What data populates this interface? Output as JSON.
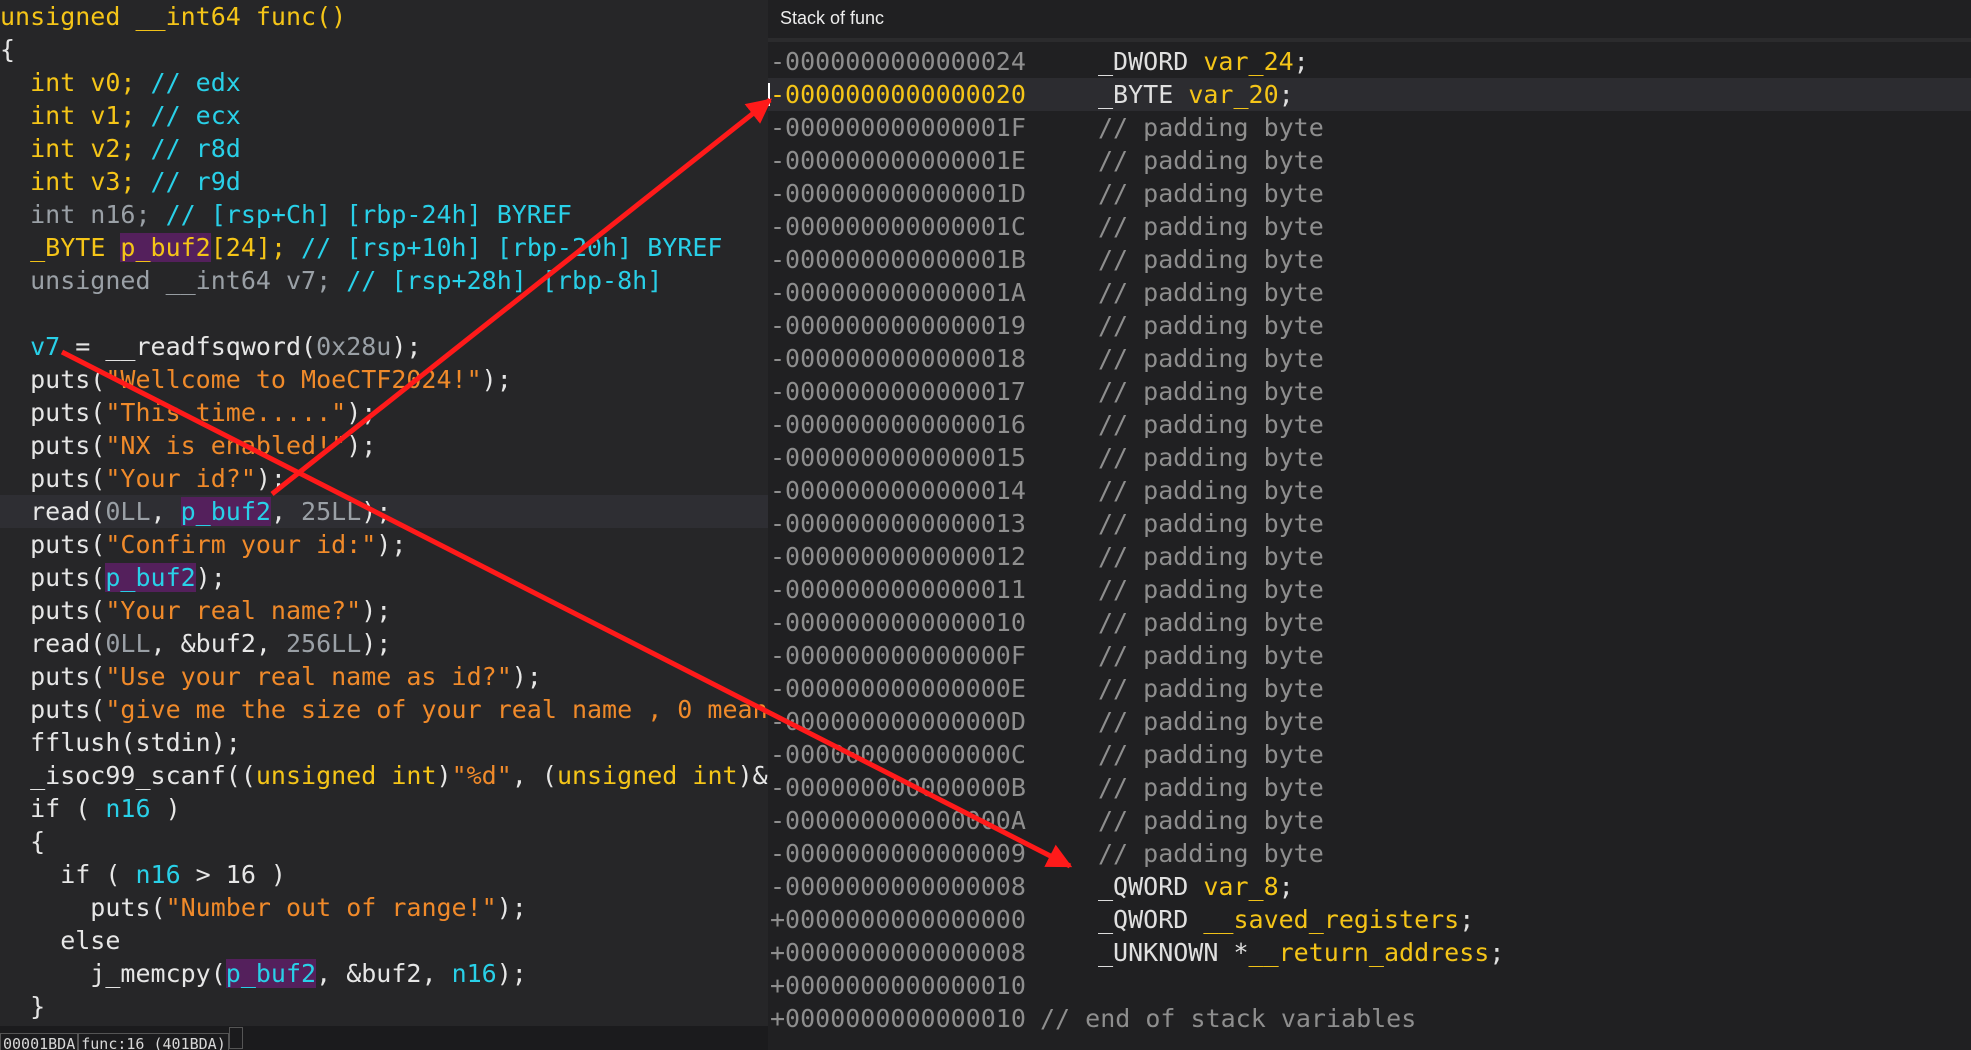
{
  "left_pane": {
    "lines": [
      {
        "segs": [
          {
            "t": "unsigned __int64 func()",
            "c": "kw"
          }
        ]
      },
      {
        "segs": [
          {
            "t": "{",
            "c": ""
          }
        ]
      },
      {
        "segs": [
          {
            "t": "  ",
            "c": ""
          },
          {
            "t": "int",
            "c": "ty"
          },
          {
            "t": " v0; ",
            "c": "kw"
          },
          {
            "t": "// edx",
            "c": "cm"
          }
        ]
      },
      {
        "segs": [
          {
            "t": "  ",
            "c": ""
          },
          {
            "t": "int",
            "c": "ty"
          },
          {
            "t": " v1; ",
            "c": "kw"
          },
          {
            "t": "// ecx",
            "c": "cm"
          }
        ]
      },
      {
        "segs": [
          {
            "t": "  ",
            "c": ""
          },
          {
            "t": "int",
            "c": "ty"
          },
          {
            "t": " v2; ",
            "c": "kw"
          },
          {
            "t": "// r8d",
            "c": "cm"
          }
        ]
      },
      {
        "segs": [
          {
            "t": "  ",
            "c": ""
          },
          {
            "t": "int",
            "c": "ty"
          },
          {
            "t": " v3; ",
            "c": "kw"
          },
          {
            "t": "// r9d",
            "c": "cm"
          }
        ]
      },
      {
        "segs": [
          {
            "t": "  int n16; ",
            "c": "dim"
          },
          {
            "t": "// [rsp+Ch] [rbp-24h] BYREF",
            "c": "cm"
          }
        ]
      },
      {
        "segs": [
          {
            "t": "  ",
            "c": ""
          },
          {
            "t": "_BYTE ",
            "c": "ty"
          },
          {
            "t": "p_buf2",
            "c": "pb"
          },
          {
            "t": "[24]; ",
            "c": "kw"
          },
          {
            "t": "// [rsp+10h] [rbp-20h] BYREF",
            "c": "cm"
          }
        ]
      },
      {
        "segs": [
          {
            "t": "  unsigned __int64 v7; ",
            "c": "dim"
          },
          {
            "t": "// [rsp+28h] [rbp-8h]",
            "c": "cm"
          }
        ]
      },
      {
        "segs": [
          {
            "t": "",
            "c": ""
          }
        ]
      },
      {
        "segs": [
          {
            "t": "  ",
            "c": ""
          },
          {
            "t": "v7",
            "c": "var"
          },
          {
            "t": " = __readfsqword(",
            "c": ""
          },
          {
            "t": "0x28u",
            "c": "dim"
          },
          {
            "t": ");",
            "c": ""
          }
        ]
      },
      {
        "segs": [
          {
            "t": "  puts(",
            "c": ""
          },
          {
            "t": "\"Wellcome to MoeCTF2024!\"",
            "c": "str"
          },
          {
            "t": ");",
            "c": ""
          }
        ]
      },
      {
        "segs": [
          {
            "t": "  puts(",
            "c": ""
          },
          {
            "t": "\"This time.....\"",
            "c": "str"
          },
          {
            "t": ");",
            "c": ""
          }
        ]
      },
      {
        "segs": [
          {
            "t": "  puts(",
            "c": ""
          },
          {
            "t": "\"NX is enabled!\"",
            "c": "str"
          },
          {
            "t": ");",
            "c": ""
          }
        ]
      },
      {
        "segs": [
          {
            "t": "  puts(",
            "c": ""
          },
          {
            "t": "\"Your id?\"",
            "c": "str"
          },
          {
            "t": ");",
            "c": ""
          }
        ]
      },
      {
        "hl": true,
        "segs": [
          {
            "t": "  read(",
            "c": ""
          },
          {
            "t": "0LL",
            "c": "dim"
          },
          {
            "t": ", ",
            "c": ""
          },
          {
            "t": "p_buf2",
            "c": "pbv"
          },
          {
            "t": ", ",
            "c": ""
          },
          {
            "t": "25LL",
            "c": "dim"
          },
          {
            "t": ");",
            "c": ""
          }
        ]
      },
      {
        "segs": [
          {
            "t": "  puts(",
            "c": ""
          },
          {
            "t": "\"Confirm your id:\"",
            "c": "str"
          },
          {
            "t": ");",
            "c": ""
          }
        ]
      },
      {
        "segs": [
          {
            "t": "  puts(",
            "c": ""
          },
          {
            "t": "p_buf2",
            "c": "pbv"
          },
          {
            "t": ");",
            "c": ""
          }
        ]
      },
      {
        "segs": [
          {
            "t": "  puts(",
            "c": ""
          },
          {
            "t": "\"Your real name?\"",
            "c": "str"
          },
          {
            "t": ");",
            "c": ""
          }
        ]
      },
      {
        "segs": [
          {
            "t": "  read(",
            "c": ""
          },
          {
            "t": "0LL",
            "c": "dim"
          },
          {
            "t": ", &buf2, ",
            "c": ""
          },
          {
            "t": "256LL",
            "c": "dim"
          },
          {
            "t": ");",
            "c": ""
          }
        ]
      },
      {
        "segs": [
          {
            "t": "  puts(",
            "c": ""
          },
          {
            "t": "\"Use your real name as id?\"",
            "c": "str"
          },
          {
            "t": ");",
            "c": ""
          }
        ]
      },
      {
        "segs": [
          {
            "t": "  puts(",
            "c": ""
          },
          {
            "t": "\"give me the size of your real name , 0 mean",
            "c": "str"
          }
        ]
      },
      {
        "segs": [
          {
            "t": "  fflush(stdin);",
            "c": ""
          }
        ]
      },
      {
        "segs": [
          {
            "t": "  _isoc99_scanf((",
            "c": ""
          },
          {
            "t": "unsigned int",
            "c": "ty"
          },
          {
            "t": ")",
            "c": ""
          },
          {
            "t": "\"%d\"",
            "c": "str"
          },
          {
            "t": ", (",
            "c": ""
          },
          {
            "t": "unsigned int",
            "c": "ty"
          },
          {
            "t": ")&",
            "c": ""
          }
        ]
      },
      {
        "segs": [
          {
            "t": "  if ( ",
            "c": ""
          },
          {
            "t": "n16",
            "c": "var"
          },
          {
            "t": " )",
            "c": ""
          }
        ]
      },
      {
        "segs": [
          {
            "t": "  {",
            "c": ""
          }
        ]
      },
      {
        "segs": [
          {
            "t": "    if ( ",
            "c": ""
          },
          {
            "t": "n16",
            "c": "var"
          },
          {
            "t": " > 16 )",
            "c": ""
          }
        ]
      },
      {
        "segs": [
          {
            "t": "      puts(",
            "c": ""
          },
          {
            "t": "\"Number out of range!\"",
            "c": "str"
          },
          {
            "t": ");",
            "c": ""
          }
        ]
      },
      {
        "segs": [
          {
            "t": "    else",
            "c": ""
          }
        ]
      },
      {
        "segs": [
          {
            "t": "      j_memcpy(",
            "c": ""
          },
          {
            "t": "p_buf2",
            "c": "pbv"
          },
          {
            "t": ", &buf2, ",
            "c": ""
          },
          {
            "t": "n16",
            "c": "var"
          },
          {
            "t": ");",
            "c": ""
          }
        ]
      },
      {
        "segs": [
          {
            "t": "  }",
            "c": ""
          }
        ]
      }
    ],
    "status": {
      "address": "00001BDA",
      "location": "func:16 (401BDA)"
    }
  },
  "right_pane": {
    "title": "Stack of func",
    "rows": [
      {
        "addr": "-0000000000000024",
        "type": "_DWORD ",
        "name": "var_24",
        "tail": ";"
      },
      {
        "addr": "-0000000000000020",
        "type": "_BYTE ",
        "name": "var_20",
        "tail": ";",
        "sel": true
      },
      {
        "addr": "-000000000000001F",
        "pad": "// padding byte"
      },
      {
        "addr": "-000000000000001E",
        "pad": "// padding byte"
      },
      {
        "addr": "-000000000000001D",
        "pad": "// padding byte"
      },
      {
        "addr": "-000000000000001C",
        "pad": "// padding byte"
      },
      {
        "addr": "-000000000000001B",
        "pad": "// padding byte"
      },
      {
        "addr": "-000000000000001A",
        "pad": "// padding byte"
      },
      {
        "addr": "-0000000000000019",
        "pad": "// padding byte"
      },
      {
        "addr": "-0000000000000018",
        "pad": "// padding byte"
      },
      {
        "addr": "-0000000000000017",
        "pad": "// padding byte"
      },
      {
        "addr": "-0000000000000016",
        "pad": "// padding byte"
      },
      {
        "addr": "-0000000000000015",
        "pad": "// padding byte"
      },
      {
        "addr": "-0000000000000014",
        "pad": "// padding byte"
      },
      {
        "addr": "-0000000000000013",
        "pad": "// padding byte"
      },
      {
        "addr": "-0000000000000012",
        "pad": "// padding byte"
      },
      {
        "addr": "-0000000000000011",
        "pad": "// padding byte"
      },
      {
        "addr": "-0000000000000010",
        "pad": "// padding byte"
      },
      {
        "addr": "-000000000000000F",
        "pad": "// padding byte"
      },
      {
        "addr": "-000000000000000E",
        "pad": "// padding byte"
      },
      {
        "addr": "-000000000000000D",
        "pad": "// padding byte"
      },
      {
        "addr": "-000000000000000C",
        "pad": "// padding byte"
      },
      {
        "addr": "-000000000000000B",
        "pad": "// padding byte"
      },
      {
        "addr": "-000000000000000A",
        "pad": "// padding byte"
      },
      {
        "addr": "-0000000000000009",
        "pad": "// padding byte"
      },
      {
        "addr": "-0000000000000008",
        "type": "_QWORD ",
        "name": "var_8",
        "tail": ";"
      },
      {
        "addr": "+0000000000000000",
        "type": "_QWORD ",
        "name": "__saved_registers",
        "tail": ";"
      },
      {
        "addr": "+0000000000000008",
        "type": "_UNKNOWN *",
        "name": "__return_address",
        "tail": ";"
      },
      {
        "addr": "+0000000000000010"
      },
      {
        "addr": "+0000000000000010",
        "end": "// end of stack variables"
      }
    ]
  },
  "colors": {
    "arrow": "#ff1a1a",
    "keyword": "#f5c518",
    "identifier": "#29d0e8",
    "string": "#f08a2a"
  }
}
